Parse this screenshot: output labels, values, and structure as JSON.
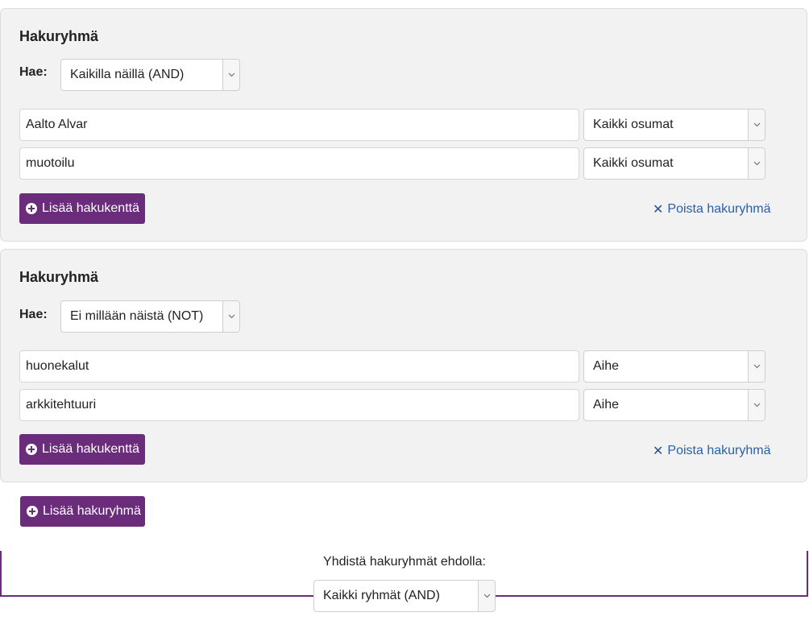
{
  "groups": [
    {
      "title": "Hakuryhmä",
      "hae_label": "Hae:",
      "operator": "Kaikilla näillä (AND)",
      "fields": [
        {
          "value": "Aalto Alvar",
          "type": "Kaikki osumat"
        },
        {
          "value": "muotoilu",
          "type": "Kaikki osumat"
        }
      ],
      "add_field_label": "Lisää hakukenttä",
      "remove_label": "Poista hakuryhmä"
    },
    {
      "title": "Hakuryhmä",
      "hae_label": "Hae:",
      "operator": "Ei millään näistä (NOT)",
      "fields": [
        {
          "value": "huonekalut",
          "type": "Aihe"
        },
        {
          "value": "arkkitehtuuri",
          "type": "Aihe"
        }
      ],
      "add_field_label": "Lisää hakukenttä",
      "remove_label": "Poista hakuryhmä"
    }
  ],
  "add_group_label": "Lisää hakuryhmä",
  "combine": {
    "label": "Yhdistä hakuryhmät ehdolla:",
    "value": "Kaikki ryhmät (AND)"
  },
  "icons": {
    "plus": "plus-circle-icon",
    "remove": "x-icon",
    "caret": "chevron-down-icon"
  },
  "colors": {
    "accent": "#6b2d7b",
    "link": "#2b5fa6",
    "panel": "#f2f2f2"
  }
}
